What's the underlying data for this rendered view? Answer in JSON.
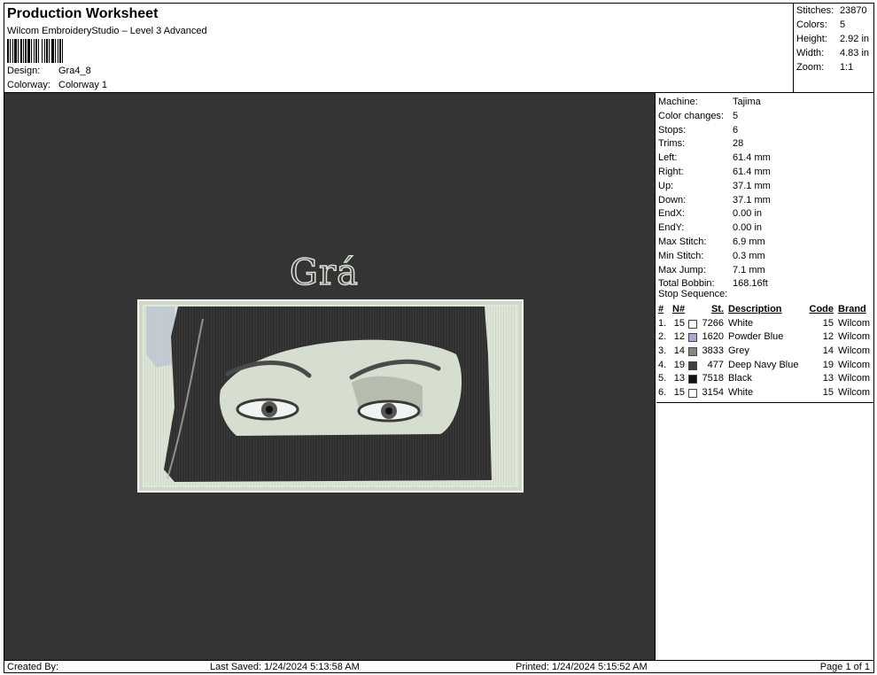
{
  "header": {
    "title": "Production Worksheet",
    "subtitle": "Wilcom EmbroideryStudio – Level 3 Advanced",
    "design_label": "Design:",
    "design_value": "Gra4_8",
    "colorway_label": "Colorway:",
    "colorway_value": "Colorway 1"
  },
  "stats": [
    {
      "label": "Stitches:",
      "value": "23870"
    },
    {
      "label": "Colors:",
      "value": "5"
    },
    {
      "label": "Height:",
      "value": "2.92 in"
    },
    {
      "label": "Width:",
      "value": "4.83 in"
    },
    {
      "label": "Zoom:",
      "value": "1:1"
    }
  ],
  "design": {
    "lettering": "Grá"
  },
  "machine_info": [
    {
      "label": "Machine:",
      "value": "Tajima"
    },
    {
      "label": "Color changes:",
      "value": "5"
    },
    {
      "label": "Stops:",
      "value": "6"
    },
    {
      "label": "Trims:",
      "value": "28"
    },
    {
      "label": "Left:",
      "value": "61.4 mm"
    },
    {
      "label": "Right:",
      "value": "61.4 mm"
    },
    {
      "label": "Up:",
      "value": "37.1 mm"
    },
    {
      "label": "Down:",
      "value": "37.1 mm"
    },
    {
      "label": "EndX:",
      "value": "0.00 in"
    },
    {
      "label": "EndY:",
      "value": "0.00 in"
    },
    {
      "label": "Max Stitch:",
      "value": "6.9 mm"
    },
    {
      "label": "Min Stitch:",
      "value": "0.3 mm"
    },
    {
      "label": "Max Jump:",
      "value": "7.1 mm"
    },
    {
      "label": "Total Bobbin:",
      "value": "168.16ft"
    }
  ],
  "stop_sequence": {
    "heading": "Stop Sequence:",
    "columns": {
      "idx": "#",
      "n": "N#",
      "st": "St.",
      "desc": "Description",
      "code": "Code",
      "brand": "Brand"
    },
    "rows": [
      {
        "idx": "1.",
        "n": "15",
        "color": "#ffffff",
        "st": "7266",
        "desc": "White",
        "code": "15",
        "brand": "Wilcom"
      },
      {
        "idx": "2.",
        "n": "12",
        "color": "#a7a9d6",
        "st": "1620",
        "desc": "Powder Blue",
        "code": "12",
        "brand": "Wilcom"
      },
      {
        "idx": "3.",
        "n": "14",
        "color": "#868686",
        "st": "3833",
        "desc": "Grey",
        "code": "14",
        "brand": "Wilcom"
      },
      {
        "idx": "4.",
        "n": "19",
        "color": "#3c3e48",
        "st": "477",
        "desc": "Deep Navy Blue",
        "code": "19",
        "brand": "Wilcom"
      },
      {
        "idx": "5.",
        "n": "13",
        "color": "#111111",
        "st": "7518",
        "desc": "Black",
        "code": "13",
        "brand": "Wilcom"
      },
      {
        "idx": "6.",
        "n": "15",
        "color": "#ffffff",
        "st": "3154",
        "desc": "White",
        "code": "15",
        "brand": "Wilcom"
      }
    ]
  },
  "footer": {
    "created_by": "Created By:",
    "last_saved": "Last Saved: 1/24/2024 5:13:58 AM",
    "printed": "Printed: 1/24/2024 5:15:52 AM",
    "page": "Page 1 of 1"
  },
  "colors": {
    "canvas_bg": "#343434",
    "patch_fill": "#dfe7d9",
    "veil": "#2e2e2e"
  }
}
